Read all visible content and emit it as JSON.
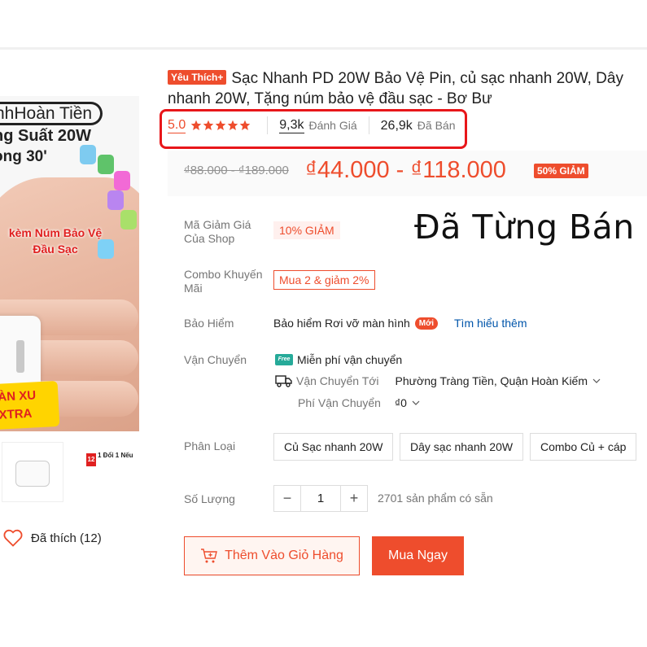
{
  "product": {
    "badge": "Yêu Thích+",
    "title_line1": "Sạc Nhanh PD 20W Bảo Vệ Pin, củ sạc nhanh 20W, Dây",
    "title_line2": "nhanh 20W, Tặng núm bảo vệ đầu sạc - Bơ Bư",
    "rating": "5.0",
    "reviews_count": "9,3k",
    "reviews_label": "Đánh Giá",
    "sold_count": "26,9k",
    "sold_label": "Đã Bán",
    "stars": 5
  },
  "image": {
    "line1": "nhHoàn Tiền",
    "line2": "ng Suất 20W",
    "line3": "ong 30'",
    "promo": "kèm Núm Bảo Vệ Đầu Sạc",
    "xu_line1": "ÀN XU",
    "xu_line2": "XTRA",
    "thumb2_badge": "12",
    "thumb2_title": "1 Đổi 1 Nếu"
  },
  "liked": {
    "label": "Đã thích (12)"
  },
  "price": {
    "old": "₫88.000 - ₫189.000",
    "new": "₫44.000 - ₫118.000",
    "discount": "50% GIẢM"
  },
  "overlay": "Đã Từng Bán",
  "voucher": {
    "label": "Mã Giảm Giá Của Shop",
    "value": "10% GIẢM"
  },
  "combo": {
    "label": "Combo Khuyến Mãi",
    "value": "Mua 2 & giảm 2%"
  },
  "insurance": {
    "label": "Bảo Hiểm",
    "text": "Bảo hiểm Rơi vỡ màn hình",
    "badge": "Mới",
    "link": "Tìm hiểu thêm"
  },
  "shipping": {
    "label": "Vận Chuyển",
    "free_icon": "Free",
    "free_text": "Miễn phí vận chuyển",
    "to_label": "Vận Chuyển Tới",
    "to_value": "Phường Tràng Tiền, Quận Hoàn Kiếm",
    "fee_label": "Phí Vận Chuyển",
    "fee_value": "₫0"
  },
  "variants": {
    "label": "Phân Loại",
    "options": [
      "Củ Sạc nhanh 20W",
      "Dây sạc nhanh 20W",
      "Combo Củ + cáp"
    ]
  },
  "quantity": {
    "label": "Số Lượng",
    "minus": "−",
    "value": "1",
    "plus": "+",
    "stock": "2701 sản phẩm có sẵn"
  },
  "actions": {
    "add_to_cart": "Thêm Vào Giỏ Hàng",
    "buy_now": "Mua Ngay"
  },
  "colors": {
    "accent": "#ee4d2d",
    "highlight_box": "#e8161a",
    "free_ship": "#26aa99",
    "link": "#0055aa"
  }
}
